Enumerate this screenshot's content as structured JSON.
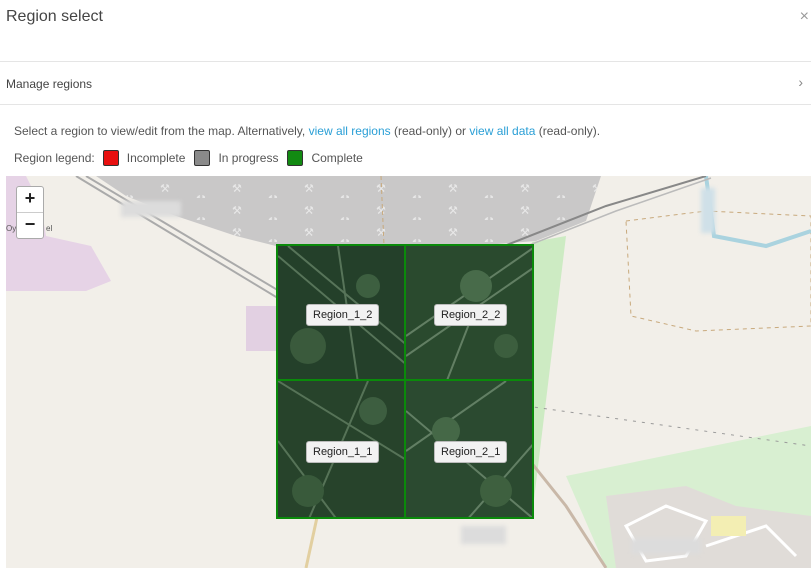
{
  "modal": {
    "title": "Region select",
    "close_symbol": "×"
  },
  "manage": {
    "label": "Manage regions",
    "chevron": "›"
  },
  "instructions": {
    "prefix": "Select a region to view/edit from the map. Alternatively,",
    "link_regions": "view all regions",
    "middle": "(read-only) or",
    "link_data": "view all data",
    "suffix": "(read-only)."
  },
  "legend": {
    "title": "Region legend:",
    "items": [
      {
        "label": "Incomplete",
        "color": "#e81010"
      },
      {
        "label": "In progress",
        "color": "#8a8a8a"
      },
      {
        "label": "Complete",
        "color": "#128a12"
      }
    ]
  },
  "map": {
    "zoom_in": "+",
    "zoom_out": "−",
    "place_fragment_a": "Oy",
    "place_fragment_b": "el",
    "regions": [
      {
        "label": "Region_1_2"
      },
      {
        "label": "Region_2_2"
      },
      {
        "label": "Region_1_1"
      },
      {
        "label": "Region_2_1"
      }
    ]
  }
}
